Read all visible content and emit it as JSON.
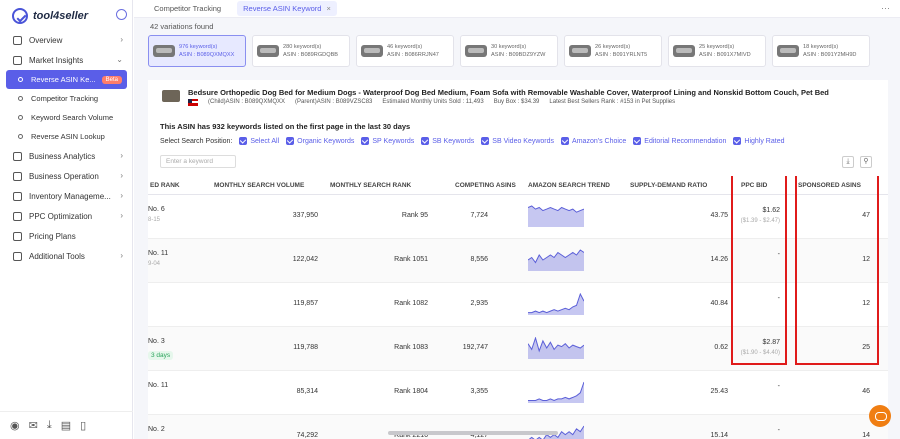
{
  "brand": {
    "name": "tool4seller"
  },
  "sidebar": {
    "items": [
      {
        "label": "Overview",
        "icon": "home-icon",
        "chevron": "›"
      },
      {
        "label": "Market Insights",
        "icon": "chart-icon",
        "chevron": "⌄"
      },
      {
        "label": "Business Analytics",
        "icon": "analytics-icon",
        "chevron": "›"
      },
      {
        "label": "Business Operation",
        "icon": "operation-icon",
        "chevron": "›"
      },
      {
        "label": "Inventory Manageme...",
        "icon": "inventory-icon",
        "chevron": "›"
      },
      {
        "label": "PPC Optimization",
        "icon": "ppc-icon",
        "chevron": "›"
      },
      {
        "label": "Pricing Plans",
        "icon": "cart-icon",
        "chevron": ""
      },
      {
        "label": "Additional Tools",
        "icon": "grid-icon",
        "chevron": "›"
      }
    ],
    "sub_items": [
      {
        "label": "Reverse ASIN Ke...",
        "badge": "Beta"
      },
      {
        "label": "Competitor Tracking"
      },
      {
        "label": "Keyword Search Volume"
      },
      {
        "label": "Reverse ASIN Lookup"
      }
    ],
    "footer_icons": [
      "user-icon",
      "mail-icon",
      "download-icon",
      "doc-icon",
      "phone-icon"
    ]
  },
  "tabs": [
    {
      "label": "Competitor Tracking"
    },
    {
      "label": "Reverse ASIN Keyword",
      "close": "×"
    }
  ],
  "variations_text": "42 variations found",
  "asin_cards": [
    {
      "keywords": "976 keyword(s)",
      "asin": "ASIN : B089QXMQXX"
    },
    {
      "keywords": "280 keyword(s)",
      "asin": "ASIN : B089RGDQBB"
    },
    {
      "keywords": "46 keyword(s)",
      "asin": "ASIN : B086RRJN47"
    },
    {
      "keywords": "30 keyword(s)",
      "asin": "ASIN : B09BDZ9YZW"
    },
    {
      "keywords": "26 keyword(s)",
      "asin": "ASIN : B091YRLNT5"
    },
    {
      "keywords": "25 keyword(s)",
      "asin": "ASIN : B091X7MIVD"
    },
    {
      "keywords": "18 keyword(s)",
      "asin": "ASIN : B091Y2MH9D"
    }
  ],
  "product": {
    "title": "Bedsure Orthopedic Dog Bed for Medium Dogs - Waterproof Dog Bed Medium, Foam Sofa with Removable Washable Cover, Waterproof Lining and Nonskid Bottom Couch, Pet Bed",
    "child_asin": "(Child)ASIN : B089QXMQXX",
    "parent_asin": "(Parent)ASIN : B089VZSC83",
    "monthly_units": "Estimated Monthly Units Sold : 11,493",
    "buy_box": "Buy Box : $34.39",
    "bsr": "Latest Best Sellers Rank : #153 in Pet Supplies"
  },
  "summary": "This ASIN has 932 keywords listed on the first page in the last 30 days",
  "search_position": {
    "label": "Select Search Position:",
    "options": [
      "Select All",
      "Organic Keywords",
      "SP Keywords",
      "SB Keywords",
      "SB Video Keywords",
      "Amazon's Choice",
      "Editorial Recommendation",
      "Highly Rated"
    ]
  },
  "keyword_input": {
    "placeholder": "Enter a keyword"
  },
  "table": {
    "headers": [
      "ED RANK",
      "MONTHLY SEARCH VOLUME",
      "MONTHLY SEARCH RANK",
      "COMPETING ASINS",
      "AMAZON SEARCH TREND",
      "SUPPLY-DEMAND RATIO",
      "PPC BID",
      "SPONSORED ASINS"
    ],
    "rows": [
      {
        "rank": "No. 6",
        "rank_sub": "8-15",
        "volume": "337,950",
        "search_rank": "Rank 95",
        "competing": "7,724",
        "ratio": "43.75",
        "bid": "$1.62",
        "bid_range": "($1.39 - $2.47)",
        "sponsored": "47",
        "trend": [
          12,
          13,
          11,
          12,
          10,
          11,
          12,
          11,
          10,
          12,
          11,
          10,
          11,
          9,
          10,
          11
        ]
      },
      {
        "rank": "No. 11",
        "rank_sub": "9-04",
        "volume": "122,042",
        "search_rank": "Rank 1051",
        "competing": "8,556",
        "ratio": "14.26",
        "bid": "-",
        "bid_range": "",
        "sponsored": "12",
        "trend": [
          4,
          5,
          3,
          6,
          4,
          5,
          6,
          5,
          7,
          6,
          5,
          6,
          7,
          6,
          8,
          7
        ]
      },
      {
        "rank": "",
        "rank_sub": "",
        "volume": "119,857",
        "search_rank": "Rank 1082",
        "competing": "2,935",
        "ratio": "40.84",
        "bid": "-",
        "bid_range": "",
        "sponsored": "12",
        "trend": [
          1,
          1,
          2,
          1,
          2,
          1,
          2,
          3,
          2,
          3,
          4,
          3,
          5,
          6,
          14,
          9
        ]
      },
      {
        "rank": "No. 3",
        "rank_sub": "3 days",
        "volume": "119,788",
        "search_rank": "Rank 1083",
        "competing": "192,747",
        "ratio": "0.62",
        "bid": "$2.87",
        "bid_range": "($1.90 - $4.40)",
        "sponsored": "25",
        "trend": [
          10,
          6,
          14,
          5,
          12,
          7,
          11,
          6,
          9,
          8,
          10,
          7,
          9,
          8,
          7,
          9
        ]
      },
      {
        "rank": "No. 11",
        "rank_sub": "",
        "volume": "85,314",
        "search_rank": "Rank 1804",
        "competing": "3,355",
        "ratio": "25.43",
        "bid": "-",
        "bid_range": "",
        "sponsored": "46",
        "trend": [
          1,
          1,
          1,
          2,
          1,
          1,
          2,
          1,
          2,
          2,
          3,
          2,
          3,
          4,
          6,
          13
        ]
      },
      {
        "rank": "No. 2",
        "rank_sub": "",
        "volume": "74,292",
        "search_rank": "Rank 2216",
        "competing": "4,127",
        "ratio": "15.14",
        "bid": "-",
        "bid_range": "",
        "sponsored": "14",
        "trend": [
          2,
          3,
          2,
          3,
          2,
          4,
          3,
          4,
          3,
          5,
          4,
          5,
          4,
          6,
          5,
          7
        ]
      }
    ]
  },
  "colors": {
    "accent": "#5a5ee8",
    "highlight": "#e01b1b",
    "trend": "#5b5fd8",
    "chat": "#f07e12"
  }
}
